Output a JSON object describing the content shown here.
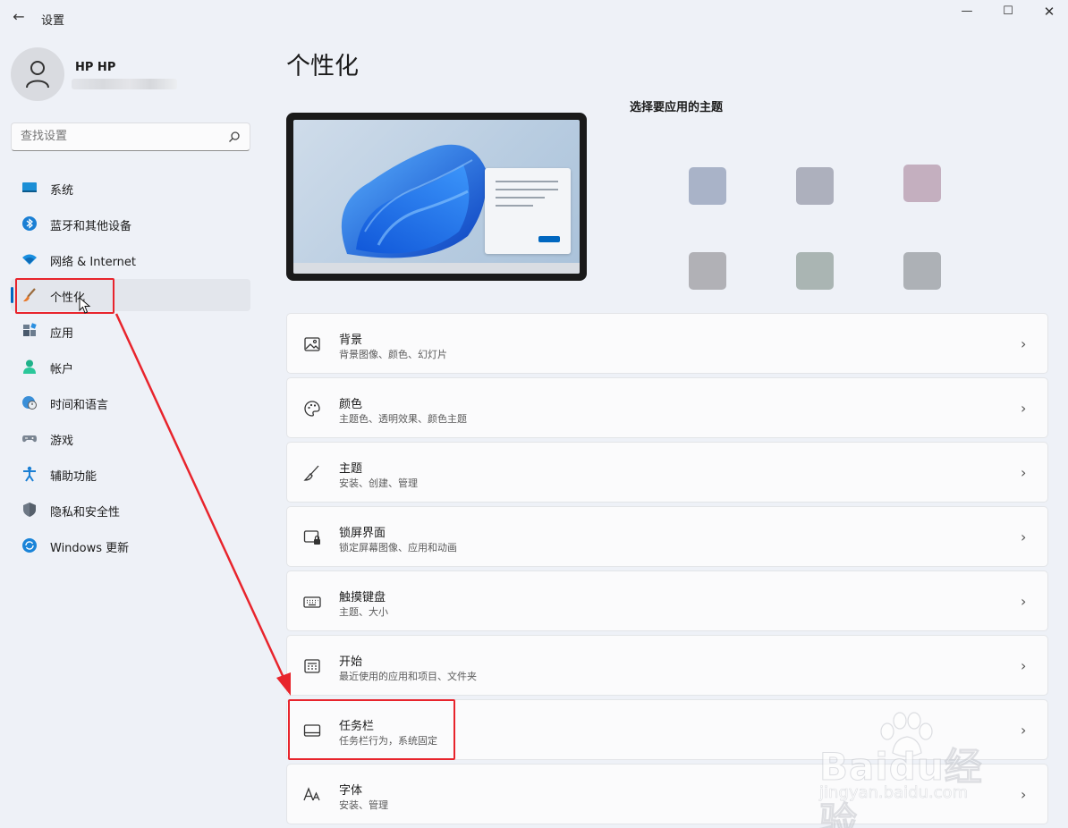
{
  "window": {
    "title": "设置",
    "back_icon": "back-arrow-icon",
    "minimize_icon": "minimize-icon",
    "maximize_icon": "maximize-icon",
    "close_icon": "close-icon"
  },
  "user": {
    "name": "HP HP",
    "avatar_icon": "user-avatar-icon"
  },
  "search": {
    "placeholder": "查找设置",
    "icon": "search-icon"
  },
  "nav": {
    "selected": "个性化",
    "items": [
      {
        "label": "系统",
        "icon": "system-monitor-icon"
      },
      {
        "label": "蓝牙和其他设备",
        "icon": "bluetooth-icon"
      },
      {
        "label": "网络 & Internet",
        "icon": "wifi-icon"
      },
      {
        "label": "个性化",
        "icon": "paintbrush-icon"
      },
      {
        "label": "应用",
        "icon": "apps-icon"
      },
      {
        "label": "帐户",
        "icon": "account-icon"
      },
      {
        "label": "时间和语言",
        "icon": "globe-clock-icon"
      },
      {
        "label": "游戏",
        "icon": "gamepad-icon"
      },
      {
        "label": "辅助功能",
        "icon": "accessibility-icon"
      },
      {
        "label": "隐私和安全性",
        "icon": "shield-icon"
      },
      {
        "label": "Windows 更新",
        "icon": "windows-update-icon"
      }
    ]
  },
  "page": {
    "title": "个性化",
    "theme_heading": "选择要应用的主题",
    "theme_swatch_colors": [
      "#a9b3c8",
      "#adb0bd",
      "#c4afbf",
      "#b1b1b6",
      "#aab5b3",
      "#adb1b6"
    ]
  },
  "cards": [
    {
      "title": "背景",
      "subtitle": "背景图像、颜色、幻灯片",
      "icon": "picture-icon"
    },
    {
      "title": "颜色",
      "subtitle": "主题色、透明效果、颜色主题",
      "icon": "palette-icon"
    },
    {
      "title": "主题",
      "subtitle": "安装、创建、管理",
      "icon": "brush-icon"
    },
    {
      "title": "锁屏界面",
      "subtitle": "锁定屏幕图像、应用和动画",
      "icon": "lock-screen-icon"
    },
    {
      "title": "触摸键盘",
      "subtitle": "主题、大小",
      "icon": "keyboard-icon"
    },
    {
      "title": "开始",
      "subtitle": "最近使用的应用和项目、文件夹",
      "icon": "start-menu-icon"
    },
    {
      "title": "任务栏",
      "subtitle": "任务栏行为，系统固定",
      "icon": "taskbar-icon"
    },
    {
      "title": "字体",
      "subtitle": "安装、管理",
      "icon": "font-icon"
    }
  ],
  "annotation": {
    "color": "#e8242c",
    "highlighted": [
      "个性化",
      "任务栏"
    ]
  },
  "watermark": {
    "brand": "Baidu经验",
    "url": "jingyan.baidu.com"
  }
}
